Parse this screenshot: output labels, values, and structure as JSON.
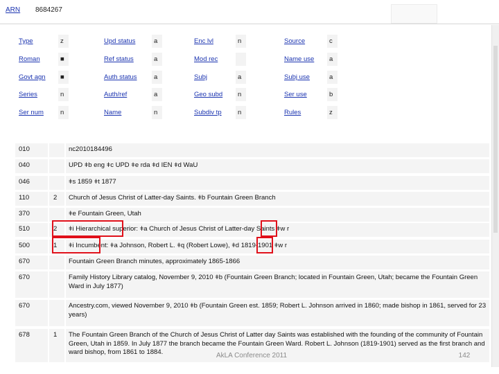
{
  "header": {
    "arn_label": "ARN",
    "arn_value": "8684267"
  },
  "fixed_fields": [
    {
      "label": "Type",
      "value": "z"
    },
    {
      "label": "Roman",
      "value": "■"
    },
    {
      "label": "Govt agn",
      "value": "■"
    },
    {
      "label": "Series",
      "value": "n"
    },
    {
      "label": "Ser num",
      "value": "n"
    },
    {
      "label": "Upd status",
      "value": "a"
    },
    {
      "label": "Ref status",
      "value": "a"
    },
    {
      "label": "Auth status",
      "value": "a"
    },
    {
      "label": "Auth/ref",
      "value": "a"
    },
    {
      "label": "Name",
      "value": "n"
    },
    {
      "label": "Enc lvl",
      "value": "n"
    },
    {
      "label": "Mod rec",
      "value": ""
    },
    {
      "label": "Subj",
      "value": "a"
    },
    {
      "label": "Geo subd",
      "value": "n"
    },
    {
      "label": "Subdiv tp",
      "value": "n"
    },
    {
      "label": "Source",
      "value": "c"
    },
    {
      "label": "Name use",
      "value": "a"
    },
    {
      "label": "Subj use",
      "value": "a"
    },
    {
      "label": "Ser use",
      "value": "b"
    },
    {
      "label": "Rules",
      "value": "z"
    }
  ],
  "fields": [
    {
      "tag": "010",
      "ind": "",
      "content": "nc2010184496"
    },
    {
      "tag": "040",
      "ind": "",
      "content": "UPD ǂb eng ǂc UPD ǂe rda ǂd IEN ǂd WaU"
    },
    {
      "tag": "046",
      "ind": "",
      "content": "ǂs 1859 ǂt 1877"
    },
    {
      "tag": "110",
      "ind": "2",
      "content": "Church of Jesus Christ of Latter-day Saints. ǂb Fountain Green Branch"
    },
    {
      "tag": "370",
      "ind": "",
      "content": "ǂe Fountain Green, Utah"
    },
    {
      "tag": "510",
      "ind": "2",
      "content": "ǂi Hierarchical superior: ǂa Church of Jesus Christ of Latter-day Saints ǂw r"
    },
    {
      "tag": "500",
      "ind": "1",
      "content": "ǂi Incumbent: ǂa Johnson, Robert L. ǂq (Robert Lowe), ǂd 1819-1901 ǂw r"
    },
    {
      "tag": "670",
      "ind": "",
      "content": "Fountain Green Branch minutes, approximately 1865-1866"
    },
    {
      "tag": "670",
      "ind": "",
      "content": "Family History Library catalog, November 9, 2010 ǂb (Fountain Green Branch; located in Fountain Green, Utah; became the Fountain Green Ward in July 1877)"
    },
    {
      "tag": "670",
      "ind": "",
      "content": "Ancestry.com, viewed November 9, 2010 ǂb (Fountain Green est. 1859; Robert L. Johnson arrived in 1860; made bishop in 1861, served for 23 years)"
    },
    {
      "tag": "678",
      "ind": "1",
      "content": "The Fountain Green Branch of the Church of Jesus Christ of Latter day Saints was established with the founding of the community of Fountain Green, Utah in 1859. In July 1877 the branch became the Fountain Green Ward. Robert L. Johnson (1819-1901) served as the first branch and ward bishop, from 1861 to 1884."
    }
  ],
  "footer": {
    "conference": "AkLA Conference 2011",
    "page": "142"
  },
  "colors": {
    "link": "#1a33b0",
    "highlight": "#e0101a",
    "cell": "#f4f4f4"
  }
}
